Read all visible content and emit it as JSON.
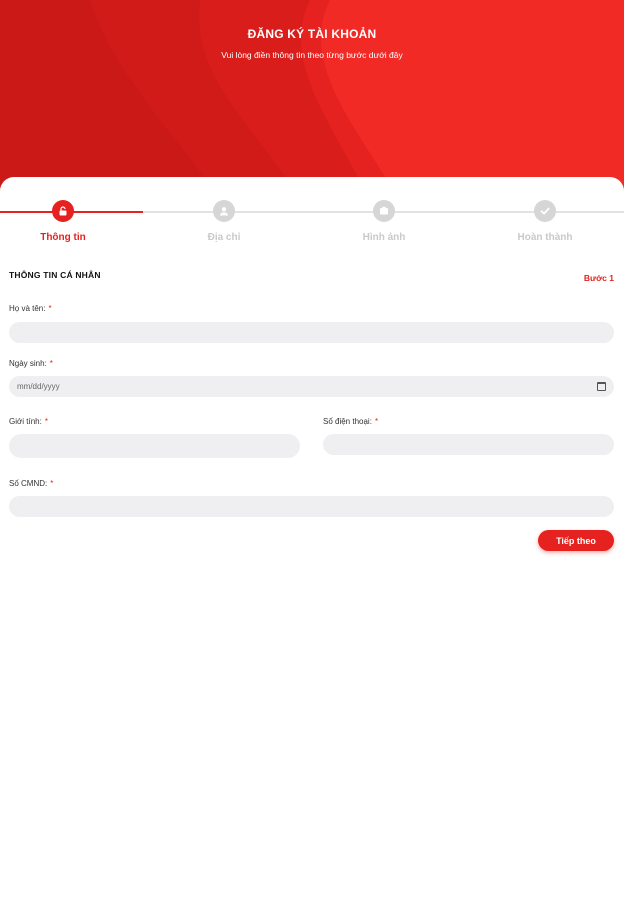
{
  "header": {
    "title": "ĐĂNG KÝ TÀI KHOẢN",
    "subtitle": "Vui lòng điền thông tin theo từng bước dưới đây"
  },
  "steps": [
    {
      "label": "Thông tin",
      "icon": "lock-icon",
      "active": true
    },
    {
      "label": "Địa chỉ",
      "icon": "user-icon",
      "active": false
    },
    {
      "label": "Hình ảnh",
      "icon": "image-icon",
      "active": false
    },
    {
      "label": "Hoàn thành",
      "icon": "check-icon",
      "active": false
    }
  ],
  "section": {
    "title": "THÔNG TIN CÁ NHÂN",
    "step_count": "Bước 1"
  },
  "form": {
    "full_name": {
      "label": "Họ và tên:",
      "required": "*",
      "value": ""
    },
    "birthdate": {
      "label": "Ngày sinh:",
      "required": "*",
      "placeholder": "mm/dd/yyyy"
    },
    "gender": {
      "label": "Giới tính:",
      "required": "*",
      "value": ""
    },
    "phone": {
      "label": "Số điện thoại:",
      "required": "*",
      "value": ""
    },
    "id_number": {
      "label": "Số CMND:",
      "required": "*",
      "value": ""
    }
  },
  "actions": {
    "next_label": "Tiếp theo"
  },
  "colors": {
    "accent": "#e5221f",
    "input_bg": "#efeff1",
    "inactive": "#d6d6d6"
  }
}
